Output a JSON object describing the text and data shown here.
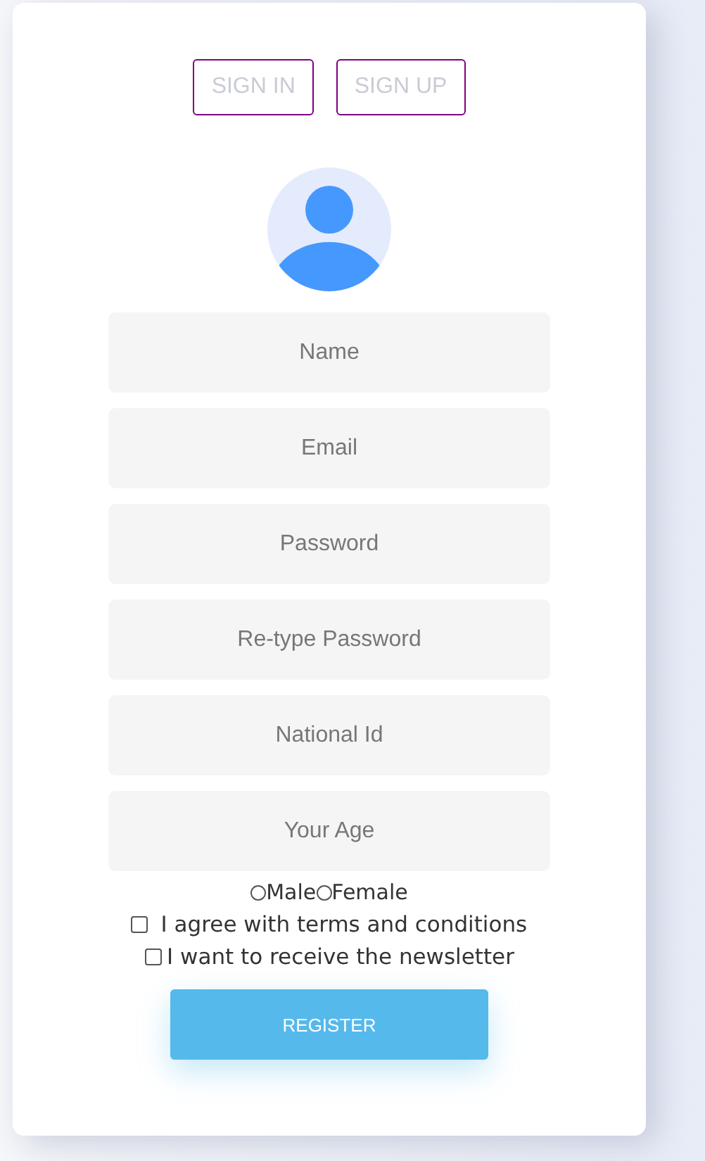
{
  "tabs": [
    {
      "label": "SIGN IN"
    },
    {
      "label": "SIGN UP"
    }
  ],
  "fields": [
    {
      "placeholder": "Name"
    },
    {
      "placeholder": "Email"
    },
    {
      "placeholder": "Password"
    },
    {
      "placeholder": "Re-type Password"
    },
    {
      "placeholder": "National Id"
    },
    {
      "placeholder": "Your Age"
    }
  ],
  "gender": [
    {
      "label": "Male",
      "selected": false
    },
    {
      "label": "Female",
      "selected": false
    }
  ],
  "checkboxes": [
    {
      "label": " I agree with terms and conditions",
      "checked": false
    },
    {
      "label": "I want to receive the newsletter",
      "checked": false
    }
  ],
  "submit": "REGISTER"
}
